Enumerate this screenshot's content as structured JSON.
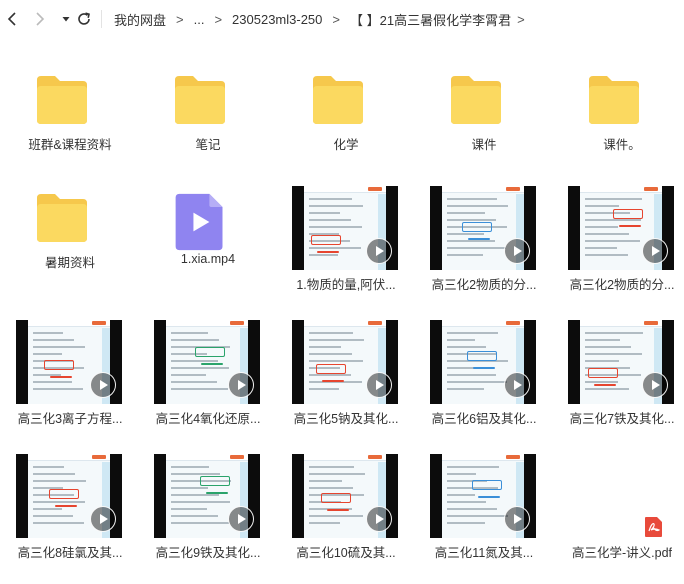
{
  "toolbar": {
    "breadcrumbs": [
      "我的网盘",
      "...",
      "230523ml3-250",
      "【 】21高三暑假化学李霄君"
    ]
  },
  "colors": {
    "folder_back": "#f6c84c",
    "folder_front": "#fbd960",
    "video_icon": "#8f84f0",
    "pdf_red": "#e84a3b"
  },
  "items": [
    {
      "type": "folder",
      "name": "班群&课程资料"
    },
    {
      "type": "folder",
      "name": "笔记"
    },
    {
      "type": "folder",
      "name": "化学"
    },
    {
      "type": "folder",
      "name": "课件"
    },
    {
      "type": "folder",
      "name": "课件。"
    },
    {
      "type": "folder",
      "name": "暑期资料"
    },
    {
      "type": "video-file",
      "name": "1.xia.mp4"
    },
    {
      "type": "video",
      "name": "1.物质的量,阿伏..."
    },
    {
      "type": "video",
      "name": "高三化2物质的分..."
    },
    {
      "type": "video",
      "name": "高三化2物质的分..."
    },
    {
      "type": "video",
      "name": "高三化3离子方程..."
    },
    {
      "type": "video",
      "name": "高三化4氧化还原..."
    },
    {
      "type": "video",
      "name": "高三化5钠及其化..."
    },
    {
      "type": "video",
      "name": "高三化6铝及其化..."
    },
    {
      "type": "video",
      "name": "高三化7铁及其化..."
    },
    {
      "type": "video",
      "name": "高三化8硅氯及其..."
    },
    {
      "type": "video",
      "name": "高三化9铁及其化..."
    },
    {
      "type": "video",
      "name": "高三化10硫及其..."
    },
    {
      "type": "video",
      "name": "高三化11氮及其..."
    },
    {
      "type": "pdf",
      "name": "高三化学-讲义.pdf"
    }
  ]
}
